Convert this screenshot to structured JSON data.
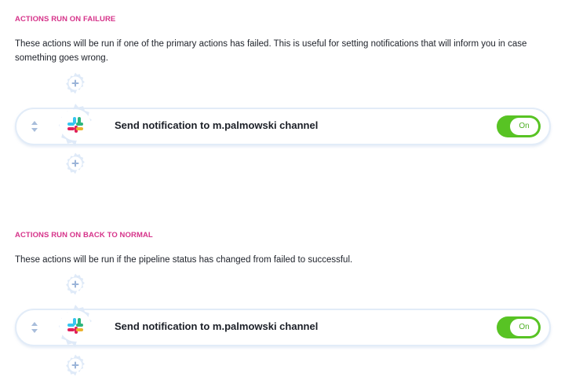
{
  "sections": [
    {
      "title": "ACTIONS RUN ON FAILURE",
      "description": "These actions will be run if one of the primary actions has failed. This is useful for setting notifications that will inform you in case something goes wrong.",
      "action": {
        "icon": "slack-icon",
        "title": "Send notification to m.palmowski channel",
        "toggle_label": "On",
        "enabled": true
      }
    },
    {
      "title": "ACTIONS RUN ON BACK TO NORMAL",
      "description": "These actions will be run if the pipeline status has changed from failed to successful.",
      "action": {
        "icon": "slack-icon",
        "title": "Send notification to m.palmowski channel",
        "toggle_label": "On",
        "enabled": true
      }
    }
  ],
  "colors": {
    "section_title": "#d6338a",
    "toggle_on": "#58c324",
    "connector": "#dce8f7",
    "plus": "#9bb4d8"
  }
}
